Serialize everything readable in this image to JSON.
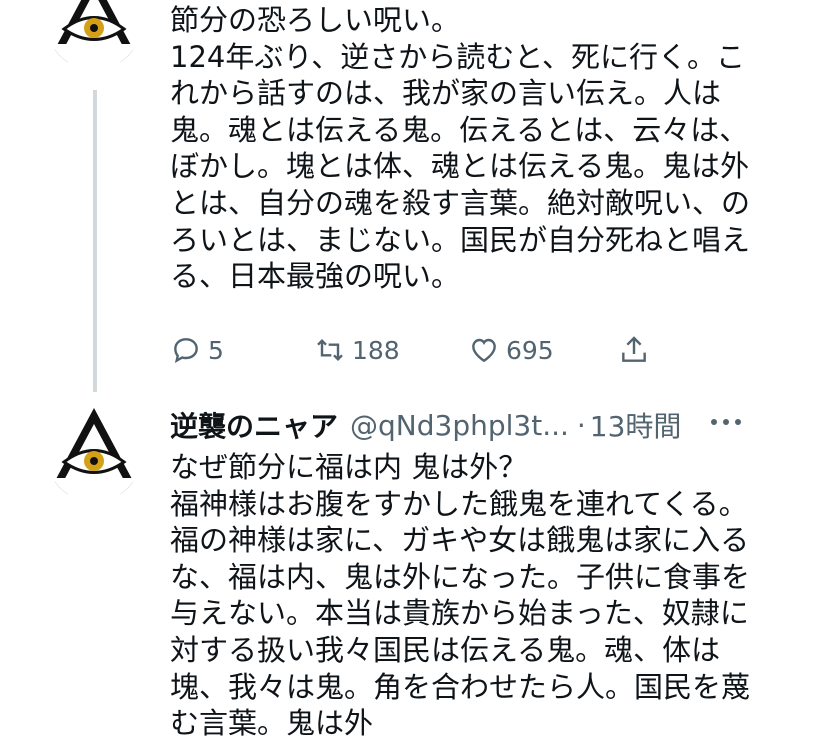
{
  "tweet1": {
    "lines": [
      "節分の恐ろしい呪い。",
      "124年ぶり、逆さから読むと、死に行く。こ",
      "れから話すのは、我が家の言い伝え。人は",
      "鬼。魂とは伝える鬼。伝えるとは、云々は、",
      "ぼかし。塊とは体、魂とは伝える鬼。鬼は外",
      "とは、自分の魂を殺す言葉。絶対敵呪い、の",
      "ろいとは、まじない。国民が自分死ねと唱え",
      "る、日本最強の呪い。"
    ],
    "actions": {
      "reply": {
        "icon": "reply-icon",
        "count": "5"
      },
      "retweet": {
        "icon": "retweet-icon",
        "count": "188"
      },
      "like": {
        "icon": "like-icon",
        "count": "695"
      },
      "share": {
        "icon": "share-icon"
      }
    }
  },
  "tweet2": {
    "display_name": "逆襲のニャア",
    "handle": "@qNd3phpl3t...",
    "separator": "·",
    "time": "13時間",
    "more_icon": "more-icon",
    "lines": [
      "なぜ節分に福は内 鬼は外？",
      "福神様はお腹をすかした餓鬼を連れてくる。",
      "福の神様は家に、ガキや女は餓鬼は家に入る",
      "な、福は内、鬼は外になった。子供に食事を",
      "与えない。本当は貴族から始まった、奴隷に",
      "対する扱い我々国民は伝える鬼。魂、体は",
      "塊、我々は鬼。角を合わせたら人。国民を蔑",
      "む言葉。鬼は外"
    ]
  },
  "colors": {
    "text": "#0f1419",
    "secondary": "#536471",
    "thread_line": "#cfd9de",
    "eye_gold": "#d4a017"
  }
}
